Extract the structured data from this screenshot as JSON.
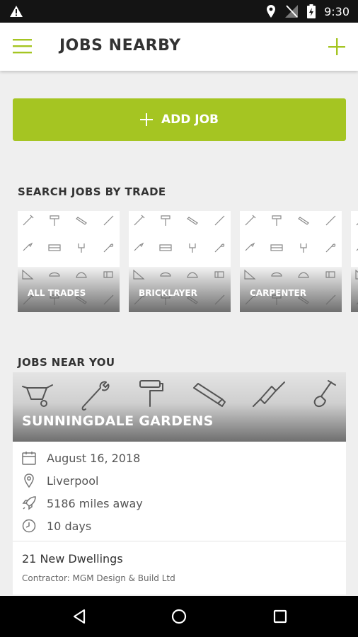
{
  "status_bar": {
    "time": "9:30",
    "icons": [
      "warning-icon",
      "location-icon",
      "no-signal-icon",
      "battery-icon"
    ]
  },
  "app_bar": {
    "title": "JOBS NEARBY",
    "menu_icon": "hamburger-icon",
    "action_icon": "plus-icon"
  },
  "add_job": {
    "label": "ADD JOB",
    "icon": "plus-icon"
  },
  "trades_section": {
    "title": "SEARCH JOBS BY TRADE",
    "items": [
      {
        "label": "ALL TRADES"
      },
      {
        "label": "BRICKLAYER"
      },
      {
        "label": "CARPENTER"
      }
    ]
  },
  "jobs_section": {
    "title": "JOBS NEAR YOU",
    "jobs": [
      {
        "title": "SUNNINGDALE GARDENS",
        "date": "August 16, 2018",
        "location": "Liverpool",
        "distance": "5186 miles away",
        "duration": "10 days",
        "name": "21 New Dwellings",
        "contractor": "Contractor: MGM Design & Build Ltd"
      }
    ]
  },
  "colors": {
    "accent": "#a5c522",
    "status_bar": "#141414",
    "background": "#efefef"
  },
  "nav_bar": {
    "icons": [
      "back-icon",
      "home-icon",
      "recents-icon"
    ]
  }
}
